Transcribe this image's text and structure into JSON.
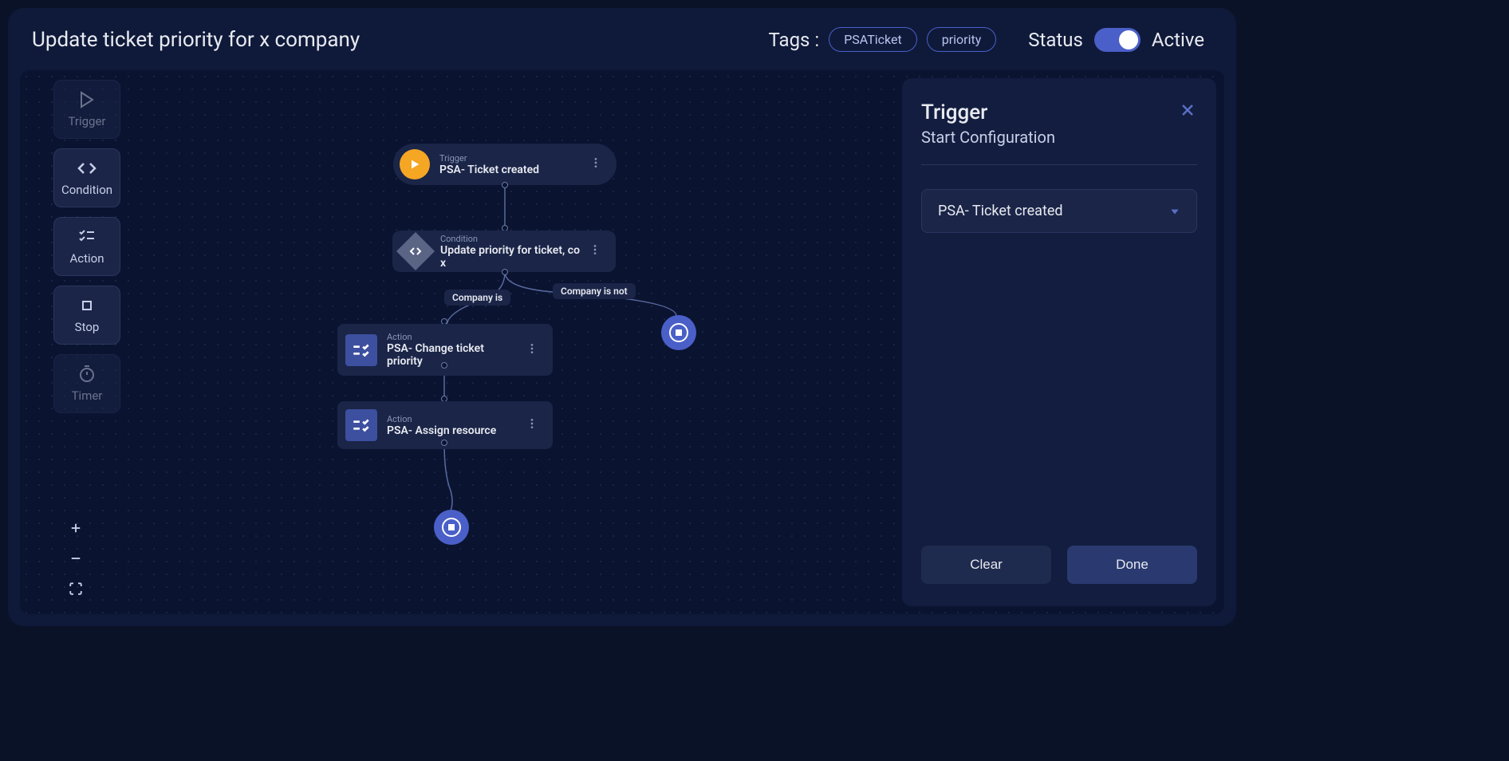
{
  "header": {
    "title": "Update ticket priority for x company",
    "tags_label": "Tags :",
    "tags": [
      "PSATicket",
      "priority"
    ],
    "status_label": "Status",
    "status_value": "Active"
  },
  "toolbox": {
    "trigger": "Trigger",
    "condition": "Condition",
    "action": "Action",
    "stop": "Stop",
    "timer": "Timer"
  },
  "nodes": {
    "trigger": {
      "type": "Trigger",
      "title": "PSA- Ticket created"
    },
    "condition": {
      "type": "Condition",
      "title": "Update priority for ticket, co x"
    },
    "action1": {
      "type": "Action",
      "title": "PSA- Change ticket priority"
    },
    "action2": {
      "type": "Action",
      "title": "PSA- Assign resource"
    },
    "branch_left": "Company is",
    "branch_right": "Company is not"
  },
  "panel": {
    "title": "Trigger",
    "subtitle": "Start Configuration",
    "dropdown_value": "PSA- Ticket created",
    "clear": "Clear",
    "done": "Done"
  }
}
